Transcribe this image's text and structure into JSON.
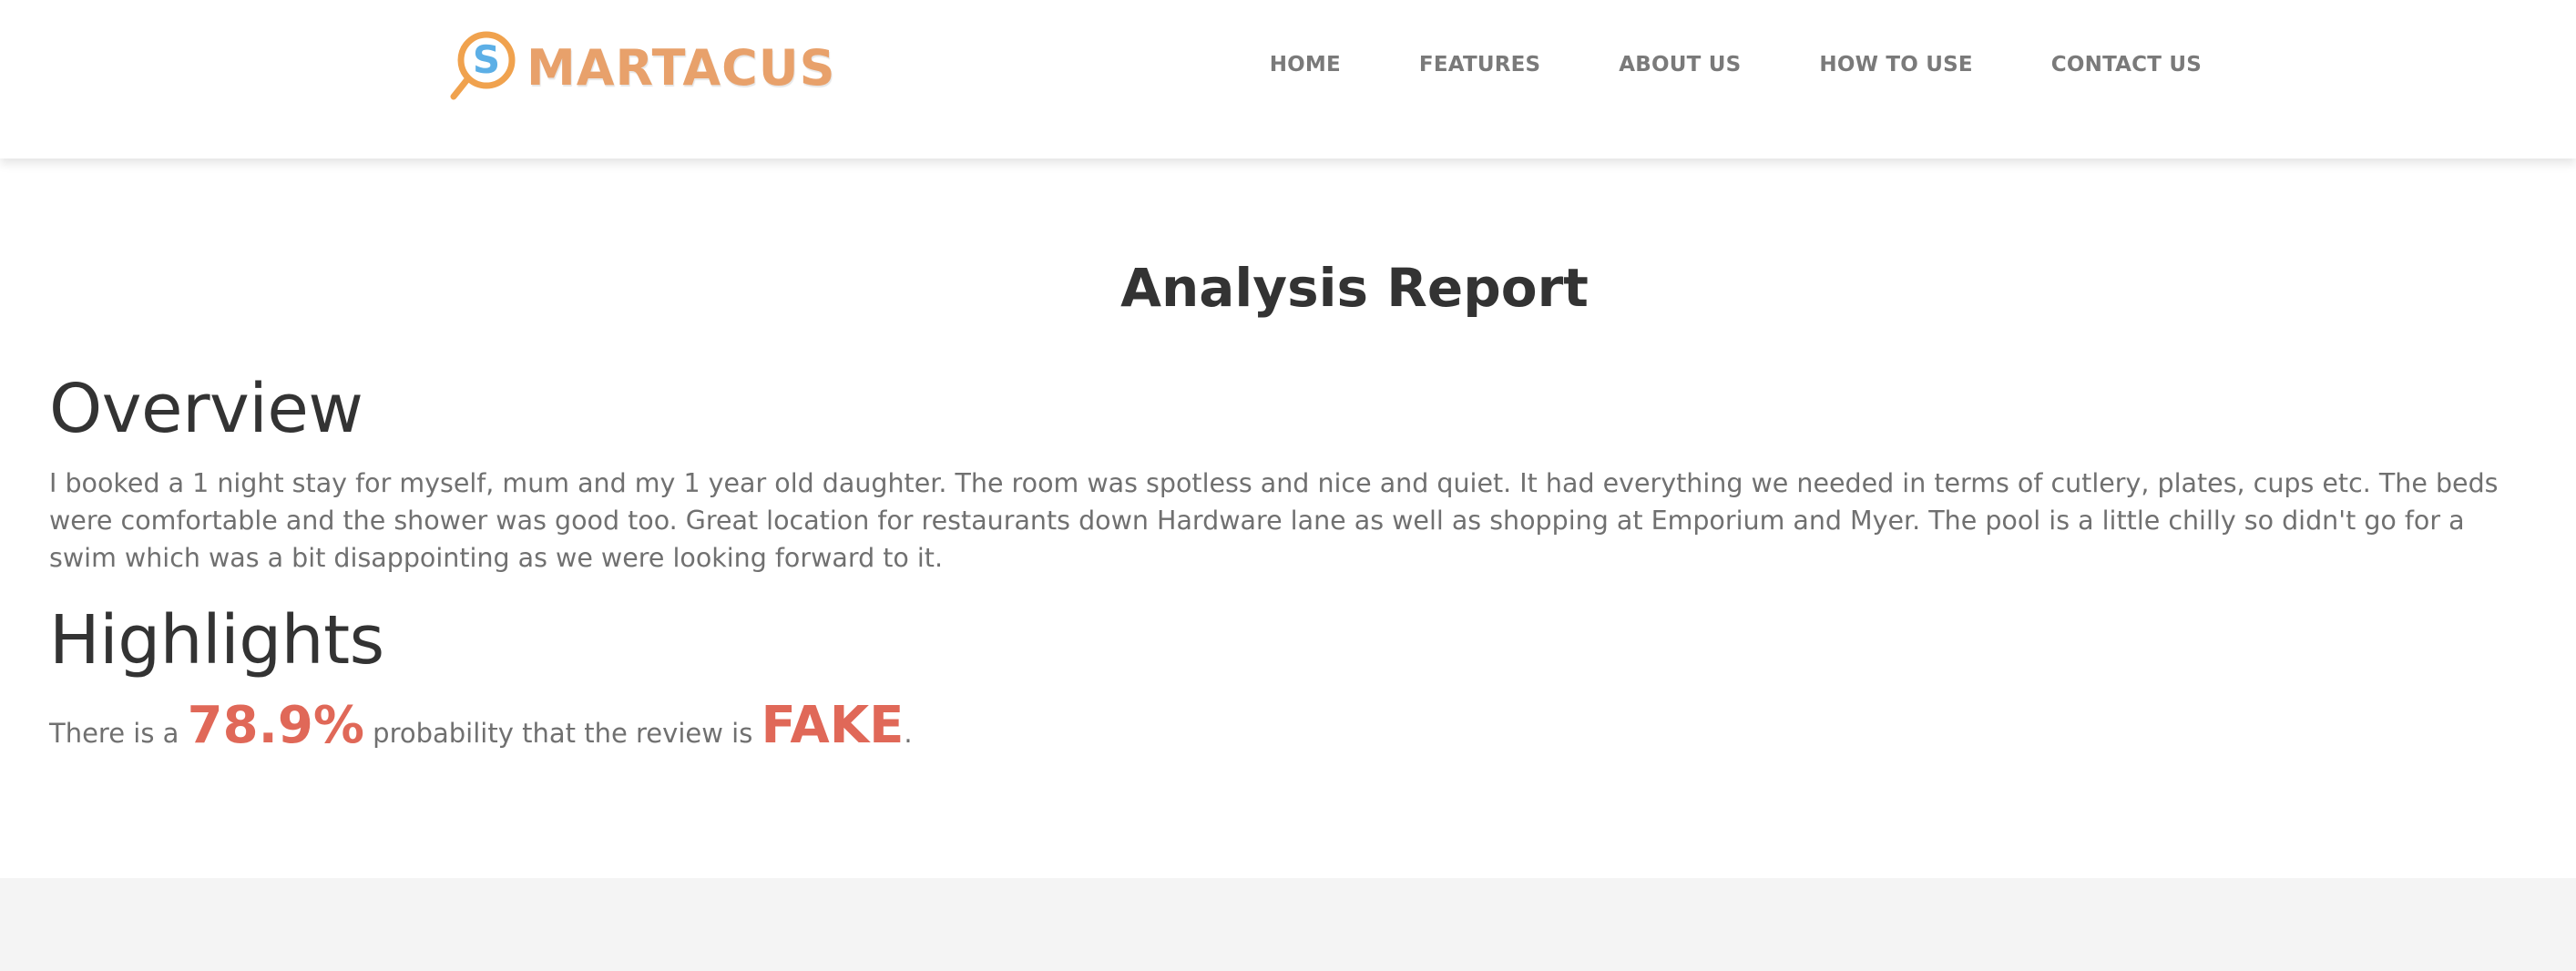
{
  "logo": {
    "text": "MARTACUS",
    "letter": "S",
    "colors": {
      "ring": "#f0a24e",
      "letter": "#5cafe6",
      "text": "#e8a16b"
    },
    "icon": "magnifier-s-icon"
  },
  "nav": {
    "items": [
      {
        "label": "HOME"
      },
      {
        "label": "FEATURES"
      },
      {
        "label": "ABOUT US"
      },
      {
        "label": "HOW TO USE"
      },
      {
        "label": "CONTACT US"
      }
    ]
  },
  "report": {
    "title": "Analysis Report",
    "overview_heading": "Overview",
    "overview_text": "I booked a 1 night stay for myself, mum and my 1 year old daughter. The room was spotless and nice and quiet. It had everything we needed in terms of cutlery, plates, cups etc. The beds were comfortable and the shower was good too. Great location for restaurants down Hardware lane as well as shopping at Emporium and Myer. The pool is a little chilly so didn't go for a swim which was a bit disappointing as we were looking forward to it.",
    "highlights_heading": "Highlights",
    "highlight": {
      "prefix": "There is a",
      "probability": "78.9%",
      "middle": "probability that the review is",
      "verdict": "FAKE",
      "suffix": "."
    }
  },
  "colors": {
    "accent_red": "#e06858",
    "heading": "#333333",
    "body_text": "#707070",
    "footer_bg": "#f4f4f4"
  }
}
